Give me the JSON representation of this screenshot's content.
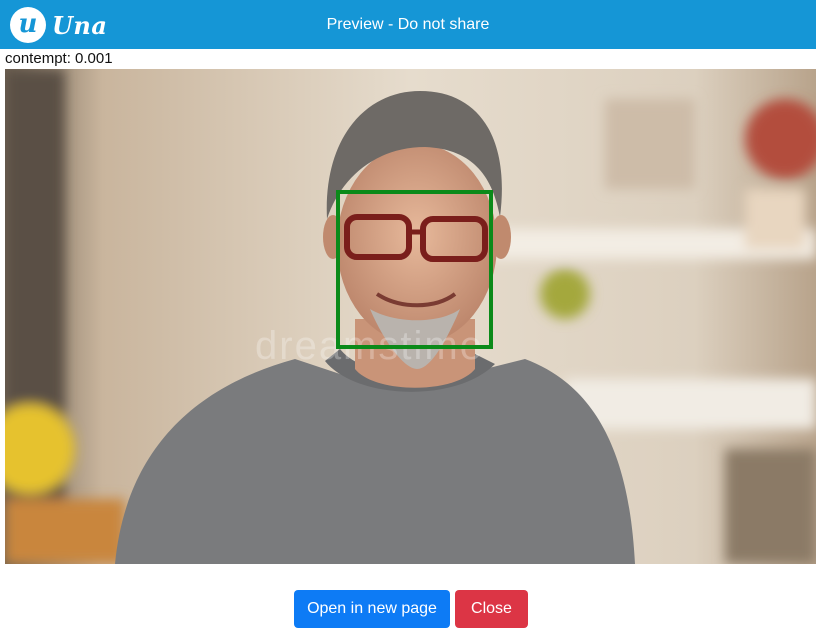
{
  "header": {
    "logo_letter": "u",
    "logo_text": "Una",
    "title": "Preview - Do not share"
  },
  "preview": {
    "emotion_label": "contempt: 0.001",
    "watermark": "dreamstime"
  },
  "actions": {
    "open_label": "Open in new page",
    "close_label": "Close"
  },
  "colors": {
    "header_bg": "#1596d6",
    "face_box": "#0b8a19",
    "open_button": "#0d7bf5",
    "close_button": "#dc3545"
  }
}
